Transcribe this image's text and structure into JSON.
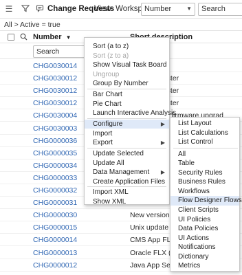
{
  "toolbar": {
    "menu_icon": "hamburger-icon",
    "filter_icon": "filter-icon",
    "chat_icon": "chat-bubble-icon",
    "title": "Change Requests",
    "view_label": "View: Workspace",
    "search_field_value": "Number",
    "search_placeholder": "Search"
  },
  "breadcrumb": {
    "text": "All > Active = true"
  },
  "list": {
    "header_number": "Number",
    "header_sort_indicator": "▼",
    "header_description": "Short description",
    "row_search_placeholder": "Search",
    "rows": [
      {
        "number": "CHG0030014",
        "desc": "ver"
      },
      {
        "number": "CHG0030012",
        "desc": "s server cluster"
      },
      {
        "number": "CHG0030012",
        "desc": "s server cluster"
      },
      {
        "number": "CHG0030012",
        "desc": "s server cluster"
      },
      {
        "number": "CHG0030004",
        "desc": "down due to firmware upgrad"
      },
      {
        "number": "CHG0030003",
        "desc": ""
      },
      {
        "number": "CHG0000036",
        "desc": ""
      },
      {
        "number": "CHG0000035",
        "desc": ""
      },
      {
        "number": "CHG0000034",
        "desc": ""
      },
      {
        "number": "CHG0000033",
        "desc": ""
      },
      {
        "number": "CHG0000032",
        "desc": ""
      },
      {
        "number": "CHG0000031",
        "desc": ""
      },
      {
        "number": "CHG0000030",
        "desc": "New version of"
      },
      {
        "number": "CHG0000015",
        "desc": "Unix update"
      },
      {
        "number": "CHG0000014",
        "desc": "CMS App FLX (d"
      },
      {
        "number": "CHG0000013",
        "desc": "Oracle FLX (Java"
      },
      {
        "number": "CHG0000012",
        "desc": "Java App Server"
      }
    ]
  },
  "context_menu": {
    "items": [
      {
        "label": "Sort (a to z)"
      },
      {
        "label": "Sort (z to a)"
      },
      {
        "label": "Show Visual Task Board"
      },
      {
        "label": "Ungroup"
      },
      {
        "label": "Group By Number"
      },
      {
        "label": "Bar Chart"
      },
      {
        "label": "Pie Chart"
      },
      {
        "label": "Launch Interactive Analysis"
      },
      {
        "label": "Configure"
      },
      {
        "label": "Import"
      },
      {
        "label": "Export"
      },
      {
        "label": "Update Selected"
      },
      {
        "label": "Update All"
      },
      {
        "label": "Data Management"
      },
      {
        "label": "Create Application Files"
      },
      {
        "label": "Import XML"
      },
      {
        "label": "Show XML"
      }
    ]
  },
  "configure_submenu": {
    "items": [
      {
        "label": "List Layout"
      },
      {
        "label": "List Calculations"
      },
      {
        "label": "List Control"
      },
      {
        "label": "All"
      },
      {
        "label": "Table"
      },
      {
        "label": "Security Rules"
      },
      {
        "label": "Business Rules"
      },
      {
        "label": "Workflows"
      },
      {
        "label": "Flow Designer Flows"
      },
      {
        "label": "Client Scripts"
      },
      {
        "label": "UI Policies"
      },
      {
        "label": "Data Policies"
      },
      {
        "label": "UI Actions"
      },
      {
        "label": "Notifications"
      },
      {
        "label": "Dictionary"
      },
      {
        "label": "Metrics"
      }
    ]
  },
  "colors": {
    "link": "#2f66b3",
    "highlight": "#dfe9f8",
    "disabled_text": "#a5a5a5"
  }
}
